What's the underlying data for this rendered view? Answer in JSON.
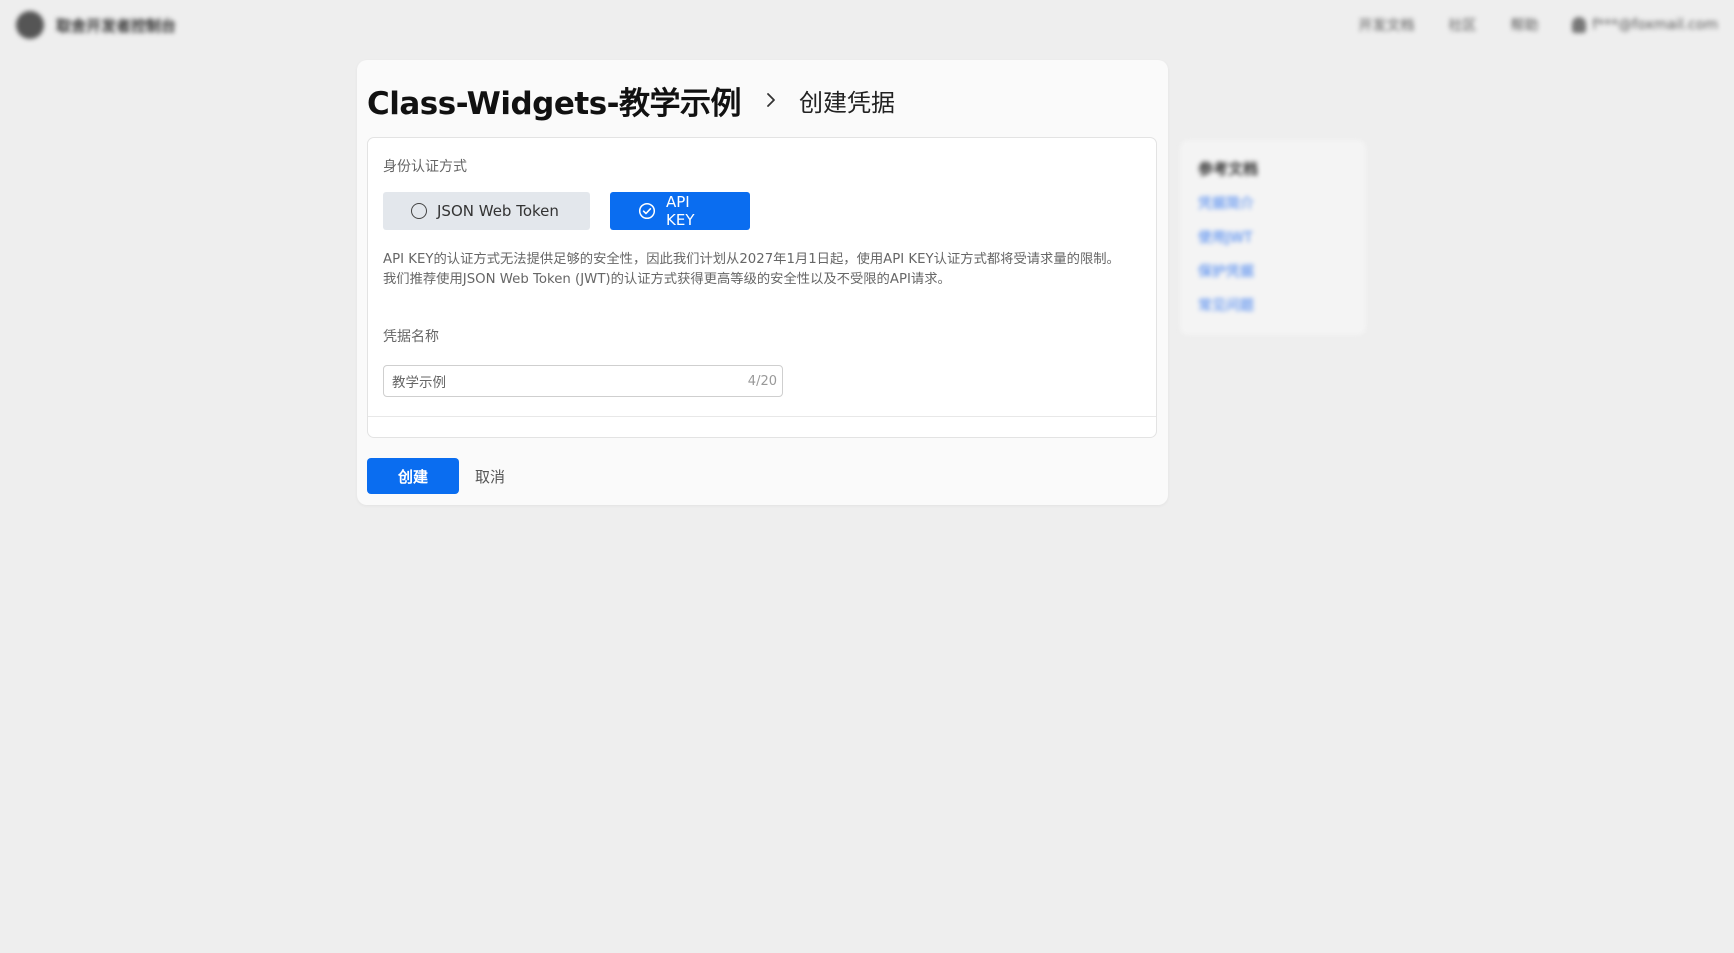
{
  "topbar": {
    "brand_name": "取舍开发者控制台",
    "nav": [
      "开发文档",
      "社区",
      "帮助"
    ],
    "user_email": "f***@foxmail.com"
  },
  "header": {
    "project_name": "Class-Widgets-教学示例",
    "page_title": "创建凭据"
  },
  "form": {
    "auth_label": "身份认证方式",
    "auth_options": [
      {
        "label": "JSON Web Token",
        "selected": false
      },
      {
        "label": "API KEY",
        "selected": true
      }
    ],
    "notice_line1": "API KEY的认证方式无法提供足够的安全性，因此我们计划从2027年1月1日起，使用API KEY认证方式都将受请求量的限制。",
    "notice_line2": "我们推荐使用JSON Web Token (JWT)的认证方式获得更高等级的安全性以及不受限的API请求。",
    "name_label": "凭据名称",
    "name_value": "教学示例",
    "name_count": "4/20"
  },
  "actions": {
    "create_label": "创建",
    "cancel_label": "取消"
  },
  "side_panel": {
    "title": "参考文档",
    "links": [
      "凭据简介",
      "使用JWT",
      "保护凭据",
      "常见问题"
    ]
  },
  "colors": {
    "accent": "#0a6df0",
    "background": "#eeeeee",
    "card": "#fafafa"
  },
  "icons": {
    "breadcrumb_separator": "chevron-right-icon",
    "jwt_option": "radio-empty-icon",
    "apikey_option": "check-circle-icon"
  }
}
